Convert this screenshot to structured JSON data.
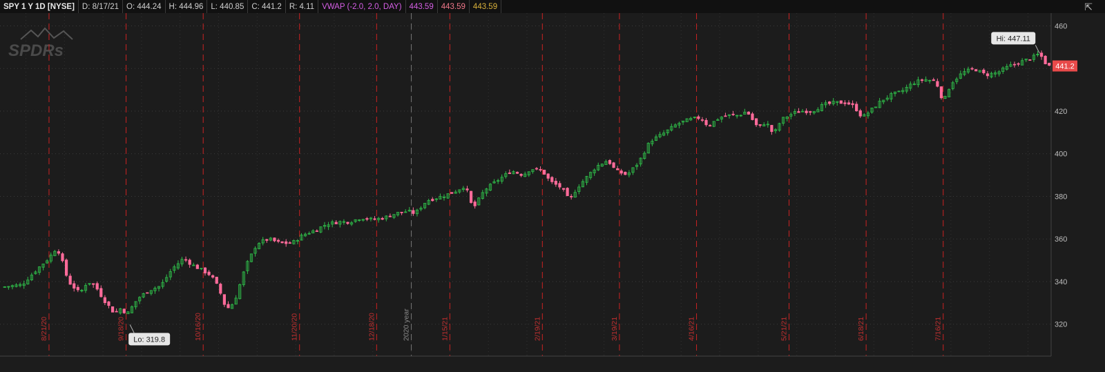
{
  "header": {
    "symbol": "SPY 1 Y 1D [NYSE]",
    "date": "D: 8/17/21",
    "open": "O: 444.24",
    "high": "H: 444.96",
    "low": "L: 440.85",
    "close": "C: 441.2",
    "range": "R: 4.11",
    "vwap_label": "VWAP (-2.0, 2.0, DAY)",
    "vwap_values": [
      "443.59",
      "443.59",
      "443.59"
    ],
    "vwap_colors": [
      "#d65fe6",
      "#f0788a",
      "#d8b03a"
    ]
  },
  "watermark": "SPDRs",
  "chart_data": {
    "type": "candlestick",
    "ylim": [
      305,
      466
    ],
    "yticks": [
      320,
      340,
      360,
      380,
      400,
      420,
      440,
      460
    ],
    "grid": true,
    "colors": {
      "up": "#2fbf4a",
      "down": "#ff6b9a",
      "background": "#1c1c1c",
      "divider": "#cc2222"
    },
    "date_markers": [
      {
        "label": "8/21/20",
        "day": 12
      },
      {
        "label": "9/18/20",
        "day": 32
      },
      {
        "label": "10/16/20",
        "day": 52
      },
      {
        "label": "11/20/20",
        "day": 77
      },
      {
        "label": "12/18/20",
        "day": 97
      },
      {
        "label": "2020 year",
        "day": 106,
        "year": true
      },
      {
        "label": "1/15/21",
        "day": 116
      },
      {
        "label": "2/19/21",
        "day": 140
      },
      {
        "label": "3/19/21",
        "day": 160
      },
      {
        "label": "4/16/21",
        "day": 180
      },
      {
        "label": "5/21/21",
        "day": 204
      },
      {
        "label": "6/18/21",
        "day": 224
      },
      {
        "label": "7/16/21",
        "day": 244
      }
    ],
    "anchors": [
      [
        0,
        337.5
      ],
      [
        5,
        338.5
      ],
      [
        9,
        346
      ],
      [
        12,
        351
      ],
      [
        14,
        356
      ],
      [
        15,
        352
      ],
      [
        17,
        340
      ],
      [
        20,
        334.5
      ],
      [
        22,
        340
      ],
      [
        24,
        338
      ],
      [
        26,
        332
      ],
      [
        29,
        325
      ],
      [
        31,
        328
      ],
      [
        32,
        324
      ],
      [
        35,
        332
      ],
      [
        38,
        336
      ],
      [
        41,
        338
      ],
      [
        44,
        346
      ],
      [
        47,
        351
      ],
      [
        49,
        348
      ],
      [
        51,
        346
      ],
      [
        54,
        343
      ],
      [
        56,
        337
      ],
      [
        58,
        327
      ],
      [
        60,
        330
      ],
      [
        63,
        347
      ],
      [
        66,
        358
      ],
      [
        69,
        360
      ],
      [
        72,
        358
      ],
      [
        75,
        358
      ],
      [
        78,
        362
      ],
      [
        81,
        364
      ],
      [
        84,
        367
      ],
      [
        87,
        368
      ],
      [
        90,
        368
      ],
      [
        93,
        370
      ],
      [
        96,
        369
      ],
      [
        99,
        370
      ],
      [
        102,
        372
      ],
      [
        105,
        373
      ],
      [
        107,
        372
      ],
      [
        110,
        378
      ],
      [
        114,
        380
      ],
      [
        117,
        382
      ],
      [
        120,
        385
      ],
      [
        122,
        374
      ],
      [
        125,
        383
      ],
      [
        128,
        387
      ],
      [
        132,
        392
      ],
      [
        135,
        390
      ],
      [
        137,
        393
      ],
      [
        140,
        392
      ],
      [
        142,
        387
      ],
      [
        145,
        384
      ],
      [
        147,
        378
      ],
      [
        149,
        384
      ],
      [
        152,
        390
      ],
      [
        154,
        394
      ],
      [
        157,
        397
      ],
      [
        159,
        392
      ],
      [
        162,
        390
      ],
      [
        165,
        396
      ],
      [
        168,
        406
      ],
      [
        171,
        409
      ],
      [
        175,
        414
      ],
      [
        178,
        416
      ],
      [
        181,
        417
      ],
      [
        183,
        413
      ],
      [
        186,
        417
      ],
      [
        188,
        418
      ],
      [
        191,
        418
      ],
      [
        193,
        420
      ],
      [
        196,
        412
      ],
      [
        198,
        415
      ],
      [
        200,
        409
      ],
      [
        202,
        416
      ],
      [
        205,
        419
      ],
      [
        207,
        420
      ],
      [
        210,
        420
      ],
      [
        213,
        423
      ],
      [
        216,
        424
      ],
      [
        219,
        424
      ],
      [
        221,
        422
      ],
      [
        223,
        417
      ],
      [
        225,
        420
      ],
      [
        228,
        425
      ],
      [
        231,
        428
      ],
      [
        233,
        429
      ],
      [
        236,
        433
      ],
      [
        239,
        435
      ],
      [
        242,
        434
      ],
      [
        243,
        430
      ],
      [
        244,
        424
      ],
      [
        246,
        433
      ],
      [
        249,
        438
      ],
      [
        252,
        440
      ],
      [
        255,
        437
      ],
      [
        258,
        438
      ],
      [
        261,
        441
      ],
      [
        264,
        443
      ],
      [
        267,
        445
      ],
      [
        269,
        447
      ],
      [
        271,
        441.2
      ]
    ],
    "total_days": 272,
    "hi": {
      "label": "Hi: 447.11",
      "value": 447.11,
      "day": 269
    },
    "lo": {
      "label": "Lo: 319.8",
      "value": 319.8,
      "day": 33
    },
    "last": {
      "label": "441.2",
      "value": 441.2
    }
  }
}
